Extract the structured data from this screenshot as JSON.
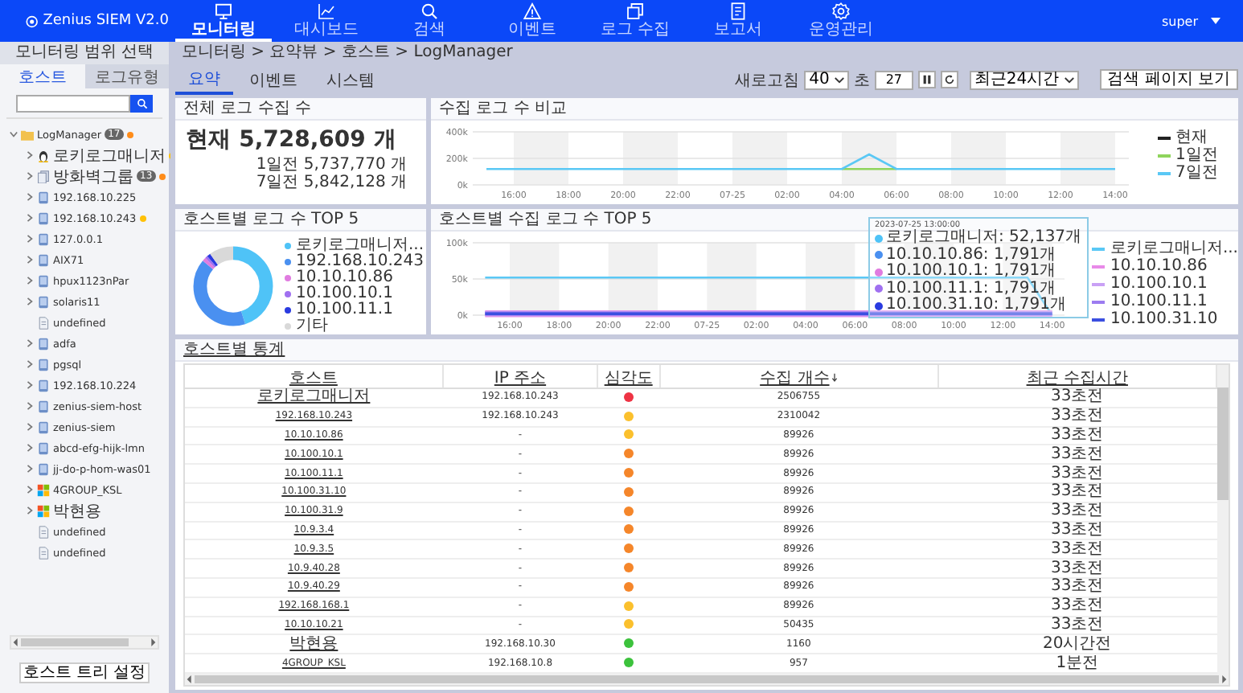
{
  "nav": {
    "brand": "Zenius SIEM V2.0",
    "user": "super",
    "items": [
      {
        "label": "모니터링",
        "selected": true
      },
      {
        "label": "대시보드",
        "selected": false
      },
      {
        "label": "검색",
        "selected": false
      },
      {
        "label": "이벤트",
        "selected": false
      },
      {
        "label": "로그 수집",
        "selected": false
      },
      {
        "label": "보고서",
        "selected": false
      },
      {
        "label": "운영관리",
        "selected": false
      }
    ]
  },
  "sidebar": {
    "title": "모니터링 범위 선택",
    "tabs": [
      {
        "label": "호스트",
        "selected": true
      },
      {
        "label": "로그유형",
        "selected": false
      }
    ],
    "tree": [
      {
        "label": "LogManager",
        "kind": "folder",
        "badge": "17",
        "color": "#ff8c1a",
        "expandable": true,
        "expanded": true,
        "children": [
          {
            "label": "로키로그매니저",
            "kind": "linux",
            "color": "#ffc107",
            "expandable": true,
            "expanded": false
          },
          {
            "label": "방화벽그룹",
            "kind": "group",
            "badge": "13",
            "color": "#ff8c1a",
            "expandable": true,
            "expanded": false
          },
          {
            "label": "192.168.10.225",
            "kind": "server",
            "expandable": true,
            "expanded": false
          },
          {
            "label": "192.168.10.243",
            "kind": "server",
            "color": "#ffc107",
            "expandable": true,
            "expanded": false
          },
          {
            "label": "127.0.0.1",
            "kind": "server",
            "expandable": true,
            "expanded": false
          },
          {
            "label": "AIX71",
            "kind": "server",
            "expandable": true,
            "expanded": false
          },
          {
            "label": "hpux1123nPar",
            "kind": "server",
            "expandable": true,
            "expanded": false
          },
          {
            "label": "solaris11",
            "kind": "server",
            "expandable": true,
            "expanded": false
          },
          {
            "label": "undefined",
            "kind": "doc",
            "expandable": false,
            "expanded": false
          },
          {
            "label": "adfa",
            "kind": "server",
            "expandable": true,
            "expanded": false
          },
          {
            "label": "pgsql",
            "kind": "server",
            "expandable": true,
            "expanded": false
          },
          {
            "label": "192.168.10.224",
            "kind": "server",
            "expandable": true,
            "expanded": false
          },
          {
            "label": "zenius-siem-host",
            "kind": "server",
            "expandable": true,
            "expanded": false
          },
          {
            "label": "zenius-siem",
            "kind": "server",
            "expandable": true,
            "expanded": false
          },
          {
            "label": "abcd-efg-hijk-lmn",
            "kind": "server",
            "expandable": true,
            "expanded": false
          },
          {
            "label": "jj-do-p-hom-was01",
            "kind": "server",
            "expandable": true,
            "expanded": false
          },
          {
            "label": "4GROUP_KSL",
            "kind": "windows",
            "expandable": true,
            "expanded": false
          },
          {
            "label": "박현용",
            "kind": "windows",
            "expandable": true,
            "expanded": false
          },
          {
            "label": "undefined",
            "kind": "doc",
            "expandable": false,
            "expanded": false
          },
          {
            "label": "undefined",
            "kind": "doc",
            "expandable": false,
            "expanded": false
          }
        ]
      }
    ],
    "tree_button": "호스트 트리 설정"
  },
  "breadcrumb": "모니터링 > 요약뷰 > 호스트 > LogManager",
  "tabs": [
    {
      "label": "요약",
      "selected": true
    },
    {
      "label": "이벤트",
      "selected": false
    },
    {
      "label": "시스템",
      "selected": false
    }
  ],
  "toolbar": {
    "refresh_label": "새로고침",
    "refresh_value": "40",
    "unit": "초",
    "countdown": "27",
    "range": "최근24시간",
    "search_button": "검색 페이지 보기"
  },
  "total": {
    "title": "전체 로그 수집 수",
    "current": "현재 5,728,609 개",
    "day1": "1일전 5,737,770 개",
    "day7": "7일전 5,842,128 개"
  },
  "compare": {
    "title": "수집 로그 수 비교",
    "chart_data": {
      "type": "line",
      "categories": [
        null,
        "16:00",
        null,
        "18:00",
        null,
        "20:00",
        null,
        "22:00",
        null,
        "07-25",
        null,
        "02:00",
        null,
        "04:00",
        null,
        "06:00",
        null,
        "08:00",
        null,
        "10:00",
        null,
        "12:00",
        null,
        "14:00"
      ],
      "ylim": [
        0,
        400000
      ],
      "yticks": [
        {
          "value": 0,
          "label": "0k"
        },
        {
          "value": 200000,
          "label": "200k"
        },
        {
          "value": 400000,
          "label": "400k"
        }
      ],
      "series": [
        {
          "name": "현재",
          "color": "#222222",
          "values": [
            null,
            null,
            null,
            null,
            null,
            null,
            null,
            null,
            null,
            null,
            null,
            null,
            null,
            null,
            null,
            null,
            null,
            null,
            null,
            null,
            null,
            null,
            null,
            null
          ]
        },
        {
          "name": "1일전",
          "color": "#8fd45c",
          "values": [
            null,
            null,
            null,
            null,
            null,
            null,
            null,
            null,
            null,
            null,
            null,
            null,
            null,
            120000,
            120000,
            120000,
            null,
            null,
            null,
            null,
            null,
            null,
            null,
            null
          ]
        },
        {
          "name": "7일전",
          "color": "#5ac8f5",
          "values": [
            120000,
            120000,
            120000,
            120000,
            120000,
            120000,
            120000,
            120000,
            120000,
            120000,
            120000,
            120000,
            120000,
            120000,
            230000,
            120000,
            120000,
            120000,
            120000,
            120000,
            120000,
            120000,
            120000,
            120000
          ]
        }
      ]
    }
  },
  "donut": {
    "title": "호스트별 로그 수 TOP 5",
    "legend": [
      {
        "label": "로키로그매니저...",
        "color": "#4fc3f7"
      },
      {
        "label": "192.168.10.243",
        "color": "#4a90f0"
      },
      {
        "label": "10.10.10.86",
        "color": "#e07ce0"
      },
      {
        "label": "10.100.10.1",
        "color": "#a070f0"
      },
      {
        "label": "10.100.11.1",
        "color": "#2a3be0"
      },
      {
        "label": "기타",
        "color": "#d9d9d9"
      }
    ]
  },
  "top5": {
    "title": "호스트별 수집 로그 수 TOP 5",
    "chart_data": {
      "type": "line",
      "categories": [
        null,
        "16:00",
        null,
        "18:00",
        null,
        "20:00",
        null,
        "22:00",
        null,
        "07-25",
        null,
        "02:00",
        null,
        "04:00",
        null,
        "06:00",
        null,
        "08:00",
        null,
        "10:00",
        null,
        "12:00",
        null,
        "14:00"
      ],
      "ylim": [
        0,
        100000
      ],
      "yticks": [
        {
          "value": 0,
          "label": "0k"
        },
        {
          "value": 50000,
          "label": "50k"
        },
        {
          "value": 100000,
          "label": "100k"
        }
      ],
      "series": [
        {
          "name": "로키로그매니저...",
          "color": "#5ac8f5",
          "values": [
            52000,
            52000,
            52000,
            52000,
            52000,
            52000,
            52000,
            52000,
            52000,
            52000,
            52000,
            52000,
            52000,
            52000,
            52000,
            52000,
            52000,
            52000,
            52000,
            52000,
            52000,
            52000,
            52000,
            0
          ]
        },
        {
          "name": "10.10.10.86",
          "color": "#e88ae8",
          "values": [
            2000,
            2000,
            2000,
            2000,
            2000,
            2000,
            2000,
            2000,
            2000,
            2000,
            2000,
            2000,
            2000,
            2000,
            2000,
            2000,
            2000,
            2000,
            2000,
            2000,
            2000,
            2000,
            2000,
            2000
          ]
        },
        {
          "name": "10.100.10.1",
          "color": "#c9a0f5",
          "values": [
            2000,
            2000,
            2000,
            2000,
            2000,
            2000,
            2000,
            2000,
            2000,
            2000,
            2000,
            2000,
            2000,
            2000,
            2000,
            2000,
            2000,
            2000,
            2000,
            2000,
            2000,
            2000,
            2000,
            2000
          ]
        },
        {
          "name": "10.100.11.1",
          "color": "#9c7cf0",
          "values": [
            2000,
            2000,
            2000,
            2000,
            2000,
            2000,
            2000,
            2000,
            2000,
            2000,
            2000,
            2000,
            2000,
            2000,
            2000,
            2000,
            2000,
            2000,
            2000,
            2000,
            2000,
            2000,
            2000,
            2000
          ]
        },
        {
          "name": "10.100.31.10",
          "color": "#3b4fe0",
          "values": [
            2000,
            2000,
            2000,
            2000,
            2000,
            2000,
            2000,
            2000,
            2000,
            2000,
            2000,
            2000,
            2000,
            2000,
            2000,
            2000,
            2000,
            2000,
            2000,
            2000,
            2000,
            2000,
            2000,
            2000
          ]
        }
      ]
    },
    "tooltip": {
      "title": "2023-07-25 13:00:00",
      "rows": [
        {
          "text": "로키로그매니저: 52,137개",
          "color": "#4fc3f7"
        },
        {
          "text": "10.10.10.86: 1,791개",
          "color": "#4a90f0"
        },
        {
          "text": "10.100.10.1: 1,791개",
          "color": "#e07ce0"
        },
        {
          "text": "10.100.11.1: 1,791개",
          "color": "#a070f0"
        },
        {
          "text": "10.100.31.10: 1,791개",
          "color": "#2a3be0"
        }
      ]
    }
  },
  "stats": {
    "title": "호스트별 통계",
    "columns": [
      "호스트",
      "IP 주소",
      "심각도",
      "수집 개수",
      "최근 수집시간"
    ],
    "rows": [
      {
        "host": "로키로그매니저",
        "ip": "192.168.10.243",
        "color": "#ee3344",
        "count": "2506755",
        "time": "33초전"
      },
      {
        "host": "192.168.10.243",
        "ip": "192.168.10.243",
        "color": "#fbc02d",
        "count": "2310042",
        "time": "33초전"
      },
      {
        "host": "10.10.10.86",
        "ip": "-",
        "color": "#fbc02d",
        "count": "89926",
        "time": "33초전"
      },
      {
        "host": "10.100.10.1",
        "ip": "-",
        "color": "#f5862a",
        "count": "89926",
        "time": "33초전"
      },
      {
        "host": "10.100.11.1",
        "ip": "-",
        "color": "#f5862a",
        "count": "89926",
        "time": "33초전"
      },
      {
        "host": "10.100.31.10",
        "ip": "-",
        "color": "#f5862a",
        "count": "89926",
        "time": "33초전"
      },
      {
        "host": "10.100.31.9",
        "ip": "-",
        "color": "#f5862a",
        "count": "89926",
        "time": "33초전"
      },
      {
        "host": "10.9.3.4",
        "ip": "-",
        "color": "#f5862a",
        "count": "89926",
        "time": "33초전"
      },
      {
        "host": "10.9.3.5",
        "ip": "-",
        "color": "#f5862a",
        "count": "89926",
        "time": "33초전"
      },
      {
        "host": "10.9.40.28",
        "ip": "-",
        "color": "#f5862a",
        "count": "89926",
        "time": "33초전"
      },
      {
        "host": "10.9.40.29",
        "ip": "-",
        "color": "#f5862a",
        "count": "89926",
        "time": "33초전"
      },
      {
        "host": "192.168.168.1",
        "ip": "-",
        "color": "#fbc02d",
        "count": "89926",
        "time": "33초전"
      },
      {
        "host": "10.10.10.21",
        "ip": "-",
        "color": "#fbc02d",
        "count": "50435",
        "time": "33초전"
      },
      {
        "host": "박현용",
        "ip": "192.168.10.30",
        "color": "#3cc23c",
        "count": "1160",
        "time": "20시간전"
      },
      {
        "host": "4GROUP_KSL",
        "ip": "192.168.10.8",
        "color": "#3cc23c",
        "count": "957",
        "time": "1분전"
      }
    ]
  }
}
